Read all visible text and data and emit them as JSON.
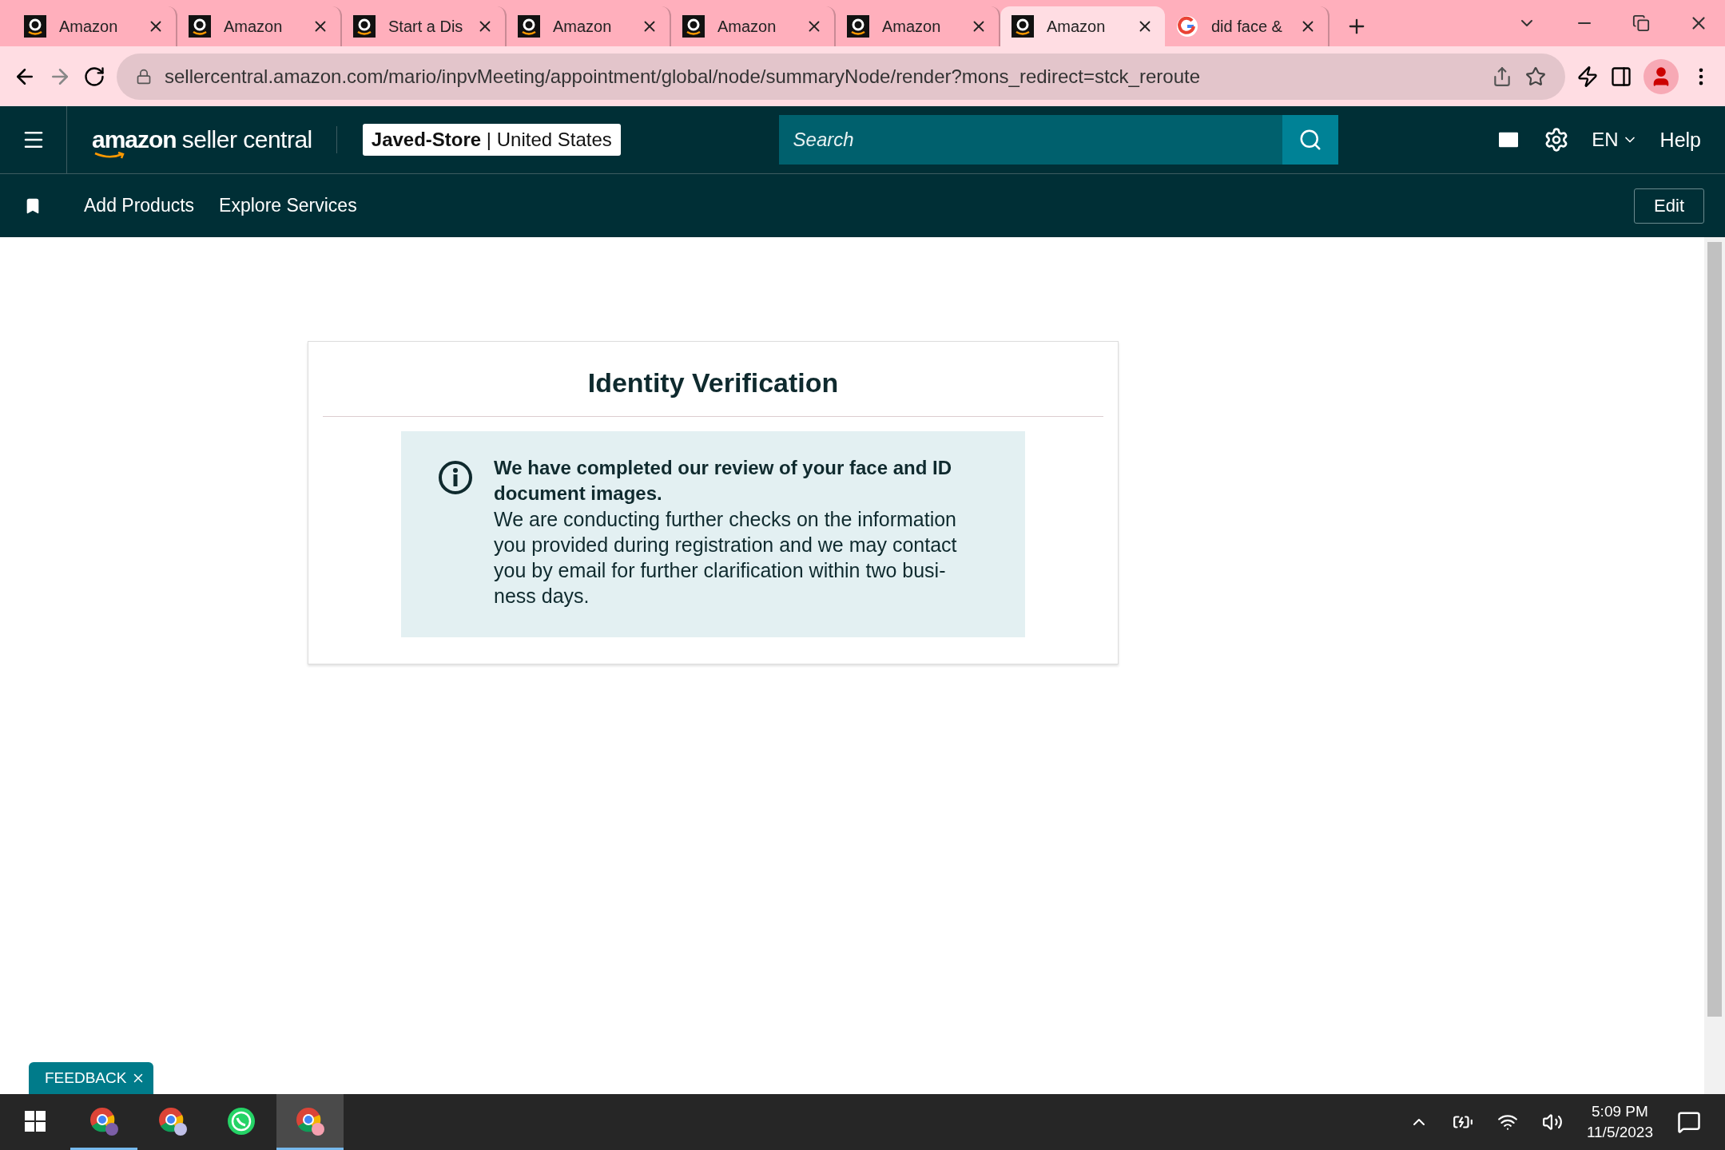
{
  "browser": {
    "tabs": [
      {
        "kind": "amazon",
        "title": "Amazon",
        "selected": false
      },
      {
        "kind": "amazon",
        "title": "Amazon",
        "selected": false
      },
      {
        "kind": "amazon",
        "title": "Start a Dis",
        "selected": false
      },
      {
        "kind": "amazon",
        "title": "Amazon",
        "selected": false
      },
      {
        "kind": "amazon",
        "title": "Amazon",
        "selected": false
      },
      {
        "kind": "amazon",
        "title": "Amazon",
        "selected": false
      },
      {
        "kind": "amazon",
        "title": "Amazon",
        "selected": true
      },
      {
        "kind": "google",
        "title": "did face &",
        "selected": false
      }
    ],
    "url": "sellercentral.amazon.com/mario/inpvMeeting/appointment/global/node/summaryNode/render?mons_redirect=stck_reroute"
  },
  "header": {
    "brand": "amazon",
    "product": "seller central",
    "store": "**Javed-Store** | United States",
    "search": {
      "placeholder": "Search"
    },
    "language": "EN",
    "help": "Help"
  },
  "nav": {
    "items": [
      "Add Products",
      "Explore Services"
    ],
    "edit": "Edit"
  },
  "card": {
    "title": "Identity Verification",
    "message_heading": "We have completed our review of your face and ID document images.",
    "message_body": "We are conducting further checks on the information you provided during registration and we may contact you by email for further clarification within two busi-ness days."
  },
  "feedback": "FEEDBACK",
  "taskbar": {
    "apps": [
      {
        "kind": "chrome",
        "running": true,
        "selected": false
      },
      {
        "kind": "chrome",
        "running": false,
        "selected": false
      },
      {
        "kind": "whatsapp",
        "running": false,
        "selected": false
      },
      {
        "kind": "chrome",
        "running": true,
        "selected": true
      }
    ],
    "time": "5:09 PM",
    "date": "11/5/2023"
  }
}
